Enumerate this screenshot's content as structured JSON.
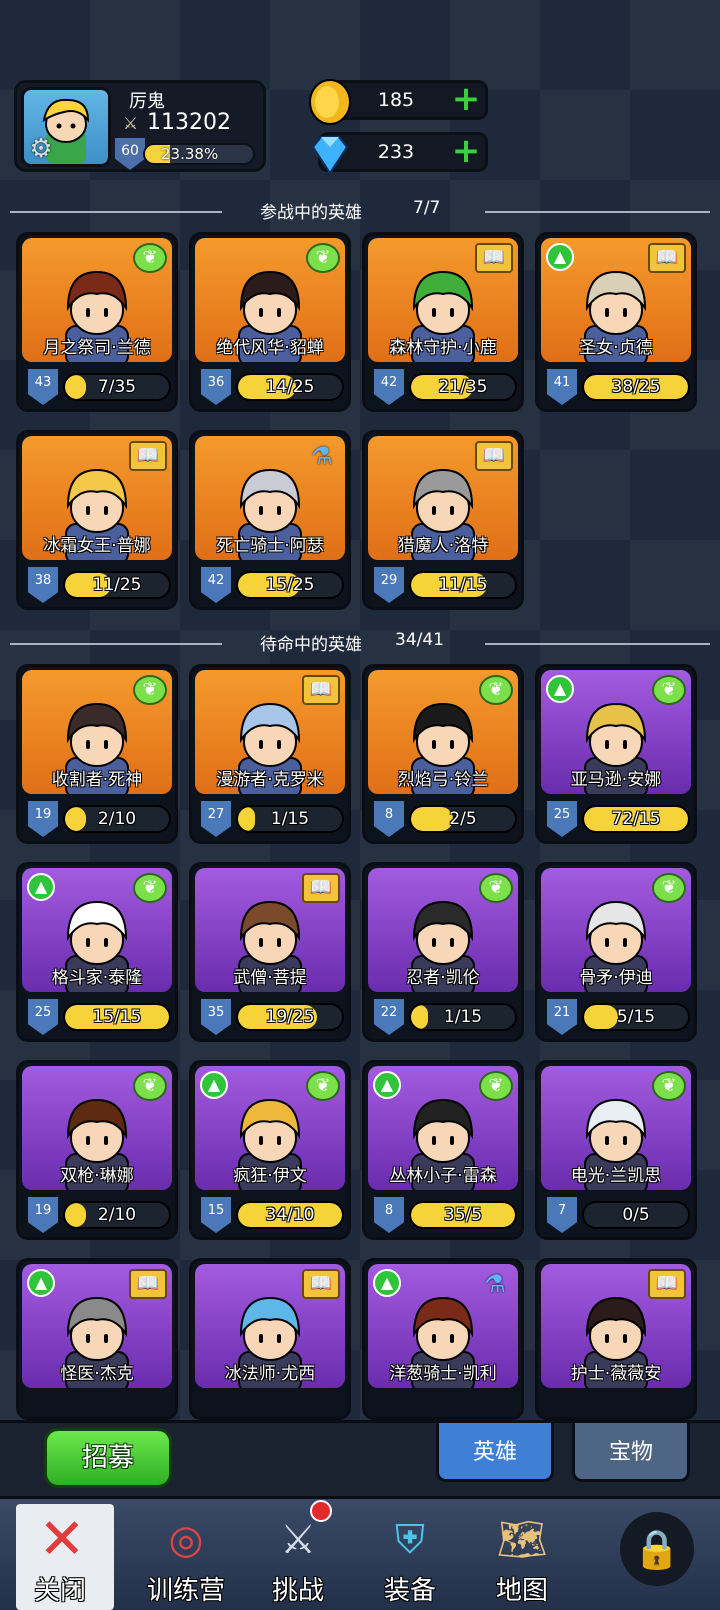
{
  "profile": {
    "name": "厉鬼",
    "power": "113202",
    "level": "60",
    "exp_percent": "23.38%",
    "exp_fraction": 0.2338
  },
  "currency": {
    "gold": "185",
    "gems": "233"
  },
  "sections": {
    "active_title": "参战中的英雄",
    "active_count": "7/7",
    "standby_title": "待命中的英雄",
    "standby_count": "34/41"
  },
  "active_heroes": [
    {
      "name": "月之祭司·兰德",
      "level": "43",
      "fragments": "7/35",
      "progress": 0.2,
      "bg": "orange",
      "badge": "wing",
      "upgrade": false
    },
    {
      "name": "绝代风华·貂蝉",
      "level": "36",
      "fragments": "14/25",
      "progress": 0.56,
      "bg": "orange",
      "badge": "wing",
      "upgrade": false
    },
    {
      "name": "森林守护·小鹿",
      "level": "42",
      "fragments": "21/35",
      "progress": 0.6,
      "bg": "orange",
      "badge": "book",
      "upgrade": false
    },
    {
      "name": "圣女·贞德",
      "level": "41",
      "fragments": "38/25",
      "progress": 1.0,
      "bg": "orange",
      "badge": "book",
      "upgrade": true
    },
    {
      "name": "冰霜女王·普娜",
      "level": "38",
      "fragments": "11/25",
      "progress": 0.44,
      "bg": "orange",
      "badge": "book",
      "upgrade": false
    },
    {
      "name": "死亡骑士·阿瑟",
      "level": "42",
      "fragments": "15/25",
      "progress": 0.6,
      "bg": "orange",
      "badge": "potion",
      "upgrade": false
    },
    {
      "name": "猎魔人·洛特",
      "level": "29",
      "fragments": "11/15",
      "progress": 0.73,
      "bg": "orange",
      "badge": "book",
      "upgrade": false
    }
  ],
  "standby_heroes": [
    {
      "name": "收割者·死神",
      "level": "19",
      "fragments": "2/10",
      "progress": 0.2,
      "bg": "orange",
      "badge": "wing",
      "upgrade": false
    },
    {
      "name": "漫游者·克罗米",
      "level": "27",
      "fragments": "1/15",
      "progress": 0.07,
      "bg": "orange",
      "badge": "book",
      "upgrade": false
    },
    {
      "name": "烈焰弓·铃兰",
      "level": "8",
      "fragments": "2/5",
      "progress": 0.4,
      "bg": "orange",
      "badge": "wing",
      "upgrade": false
    },
    {
      "name": "亚马逊·安娜",
      "level": "25",
      "fragments": "72/15",
      "progress": 1.0,
      "bg": "purple",
      "badge": "wing",
      "upgrade": true
    },
    {
      "name": "格斗家·泰隆",
      "level": "25",
      "fragments": "15/15",
      "progress": 1.0,
      "bg": "purple",
      "badge": "wing",
      "upgrade": true
    },
    {
      "name": "武僧·菩提",
      "level": "35",
      "fragments": "19/25",
      "progress": 0.76,
      "bg": "purple",
      "badge": "book",
      "upgrade": false
    },
    {
      "name": "忍者·凯伦",
      "level": "22",
      "fragments": "1/15",
      "progress": 0.07,
      "bg": "purple",
      "badge": "wing",
      "upgrade": false
    },
    {
      "name": "骨矛·伊迪",
      "level": "21",
      "fragments": "5/15",
      "progress": 0.33,
      "bg": "purple",
      "badge": "wing",
      "upgrade": false
    },
    {
      "name": "双枪·琳娜",
      "level": "19",
      "fragments": "2/10",
      "progress": 0.2,
      "bg": "purple",
      "badge": "wing",
      "upgrade": false
    },
    {
      "name": "疯狂·伊文",
      "level": "15",
      "fragments": "34/10",
      "progress": 1.0,
      "bg": "purple",
      "badge": "wing",
      "upgrade": true
    },
    {
      "name": "丛林小子·雷森",
      "level": "8",
      "fragments": "35/5",
      "progress": 1.0,
      "bg": "purple",
      "badge": "wing",
      "upgrade": true
    },
    {
      "name": "电光·兰凯思",
      "level": "7",
      "fragments": "0/5",
      "progress": 0.0,
      "bg": "purple",
      "badge": "wing",
      "upgrade": false
    },
    {
      "name": "怪医·杰克",
      "level": "",
      "fragments": "",
      "progress": 0,
      "bg": "purple",
      "badge": "book",
      "upgrade": true
    },
    {
      "name": "冰法师·尤西",
      "level": "",
      "fragments": "",
      "progress": 0,
      "bg": "purple",
      "badge": "book",
      "upgrade": false
    },
    {
      "name": "洋葱骑士·凯利",
      "level": "",
      "fragments": "",
      "progress": 0,
      "bg": "purple",
      "badge": "potion",
      "upgrade": true
    },
    {
      "name": "护士·薇薇安",
      "level": "",
      "fragments": "",
      "progress": 0,
      "bg": "purple",
      "badge": "book",
      "upgrade": false
    }
  ],
  "bottom": {
    "recruit": "招募",
    "tab_heroes": "英雄",
    "tab_treasure": "宝物"
  },
  "nav": {
    "close": "关闭",
    "training": "训练营",
    "challenge": "挑战",
    "equipment": "装备",
    "map": "地图"
  },
  "colors": {
    "orange_card": "#f08a22",
    "purple_card": "#8a45cc",
    "fragment_fill": "#f7d33a",
    "plus_green": "#37d33d",
    "active_tab": "#3f7fd6"
  }
}
